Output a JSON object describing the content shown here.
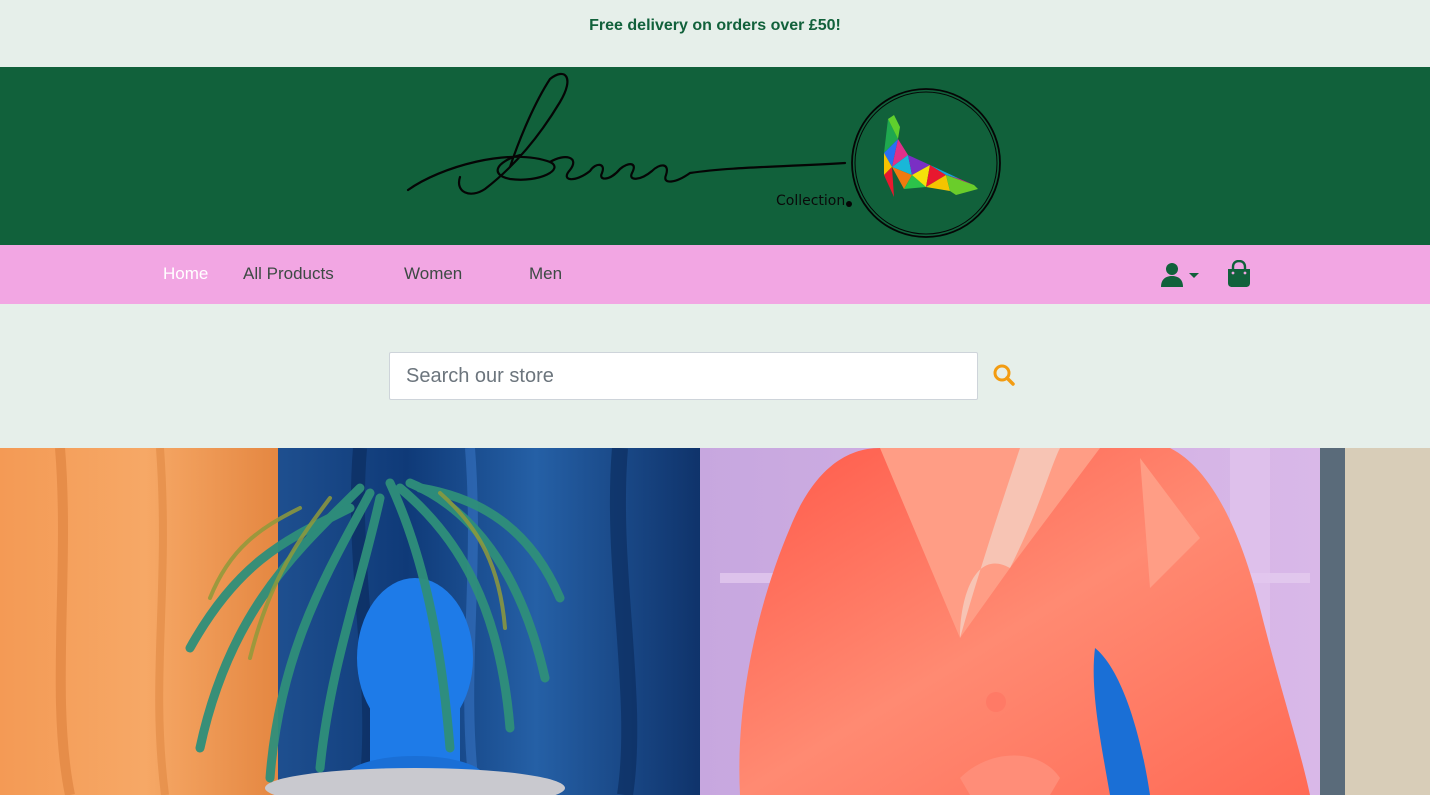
{
  "promo": {
    "text": "Free delivery on orders over £50!"
  },
  "brand": {
    "logo_text": "Sarah",
    "logo_caption": "Collection"
  },
  "nav": {
    "links": [
      {
        "label": "Home",
        "active": true
      },
      {
        "label": "All Products"
      },
      {
        "label": "Women"
      },
      {
        "label": "Men"
      }
    ],
    "account_icon": "user-icon",
    "bag_icon": "shopping-bag-icon"
  },
  "search": {
    "placeholder": "Search our store",
    "value": "",
    "icon": "search-icon"
  },
  "colors": {
    "brand_green": "#11613b",
    "nav_pink": "#f2a6e3",
    "page_bg": "#e6efea",
    "search_icon": "#f39c12"
  }
}
